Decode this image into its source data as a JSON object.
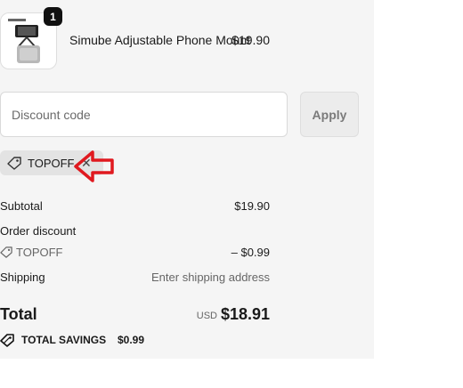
{
  "product": {
    "name": "Simube Adjustable Phone Mount",
    "price": "$19.90",
    "quantity": "1"
  },
  "discount_form": {
    "placeholder": "Discount code",
    "apply_label": "Apply"
  },
  "applied_code": {
    "code": "TOPOFF"
  },
  "summary": {
    "subtotal_label": "Subtotal",
    "subtotal_value": "$19.90",
    "order_discount_label": "Order discount",
    "discount_code": "TOPOFF",
    "discount_value": "– $0.99",
    "shipping_label": "Shipping",
    "shipping_value": "Enter shipping address",
    "total_label": "Total",
    "currency": "USD",
    "total_value": "$18.91",
    "savings_label": "TOTAL SAVINGS",
    "savings_value": "$0.99"
  },
  "colors": {
    "annotation_arrow": "#e0191f",
    "panel_background": "#f5f5f5"
  }
}
